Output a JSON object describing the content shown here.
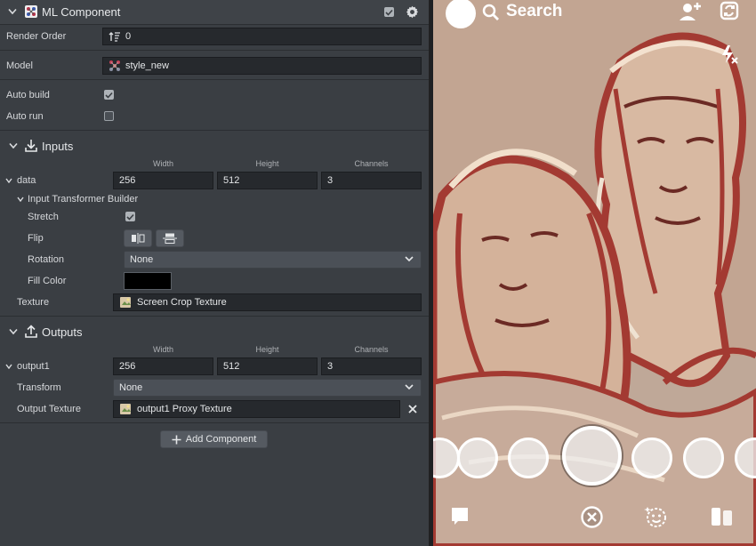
{
  "header": {
    "title": "ML Component"
  },
  "render_order": {
    "label": "Render Order",
    "value": "0"
  },
  "model": {
    "label": "Model",
    "value": "style_new"
  },
  "auto_build": {
    "label": "Auto build",
    "checked": true
  },
  "auto_run": {
    "label": "Auto run",
    "checked": false
  },
  "inputs": {
    "title": "Inputs",
    "col_headers": [
      "Width",
      "Height",
      "Channels"
    ],
    "data": {
      "label": "data",
      "width": "256",
      "height": "512",
      "channels": "3"
    },
    "transformer": {
      "label": "Input Transformer Builder",
      "stretch_label": "Stretch",
      "flip_label": "Flip",
      "rotation_label": "Rotation",
      "rotation_value": "None",
      "fill_color_label": "Fill Color",
      "fill_color": "#000000"
    },
    "texture_label": "Texture",
    "texture_value": "Screen Crop Texture"
  },
  "outputs": {
    "title": "Outputs",
    "col_headers": [
      "Width",
      "Height",
      "Channels"
    ],
    "output1": {
      "label": "output1",
      "width": "256",
      "height": "512",
      "channels": "3"
    },
    "transform_label": "Transform",
    "transform_value": "None",
    "output_texture_label": "Output Texture",
    "output_texture_value": "output1 Proxy Texture"
  },
  "add_component_label": "Add Component",
  "preview": {
    "search_label": "Search"
  },
  "colors": {
    "panel_bg": "#3a3e43",
    "field_bg": "#26292d",
    "select_bg": "#4b5057",
    "preview_accent": "#a33a32"
  }
}
